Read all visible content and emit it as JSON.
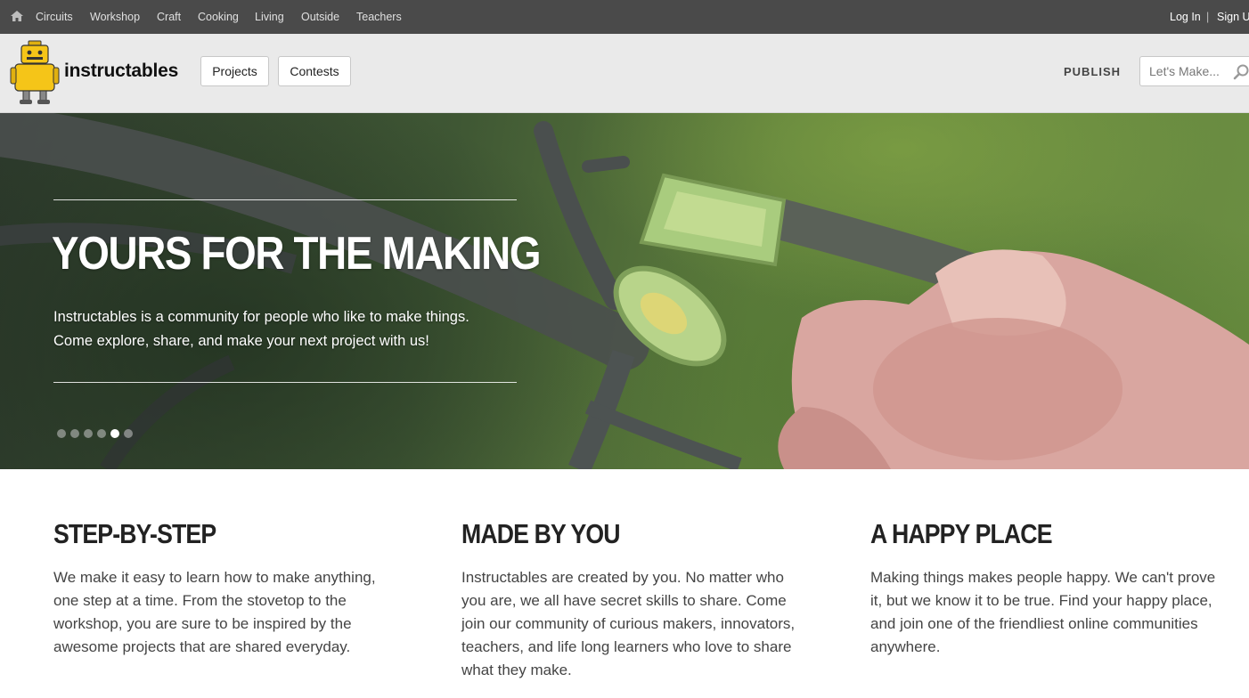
{
  "topbar": {
    "categories": [
      "Circuits",
      "Workshop",
      "Craft",
      "Cooking",
      "Living",
      "Outside",
      "Teachers"
    ],
    "login": "Log In",
    "separator": "|",
    "signup": "Sign Up"
  },
  "header": {
    "logo_text": "instructables",
    "nav": [
      "Projects",
      "Contests"
    ],
    "publish": "PUBLISH",
    "search_placeholder": "Let's Make..."
  },
  "hero": {
    "title": "YOURS FOR THE MAKING",
    "text_line1": "Instructables is a community for people who like to make things.",
    "text_line2": "Come explore, share, and make your next project with us!",
    "slide_count": 6,
    "active_slide": 5
  },
  "features": [
    {
      "title": "STEP-BY-STEP",
      "body": "We make it easy to learn how to make anything, one step at a time. From the stovetop to the workshop, you are sure to be inspired by the awesome projects that are shared everyday."
    },
    {
      "title": "MADE BY YOU",
      "body": "Instructables are created by you. No matter who you are, we all have secret skills to share. Come join our community of curious makers, innovators, teachers, and life long learners who love to share what they make."
    },
    {
      "title": "A HAPPY PLACE",
      "body": "Making things makes people happy. We can't prove it, but we know it to be true. Find your happy place, and join one of the friendliest online communities anywhere."
    }
  ],
  "colors": {
    "topbar_bg": "#4a4a4a",
    "header_bg": "#eaeaea",
    "robot_yellow": "#f5c518",
    "text_dark": "#222222"
  },
  "icons": [
    "home-icon",
    "search-icon",
    "robot-logo"
  ]
}
